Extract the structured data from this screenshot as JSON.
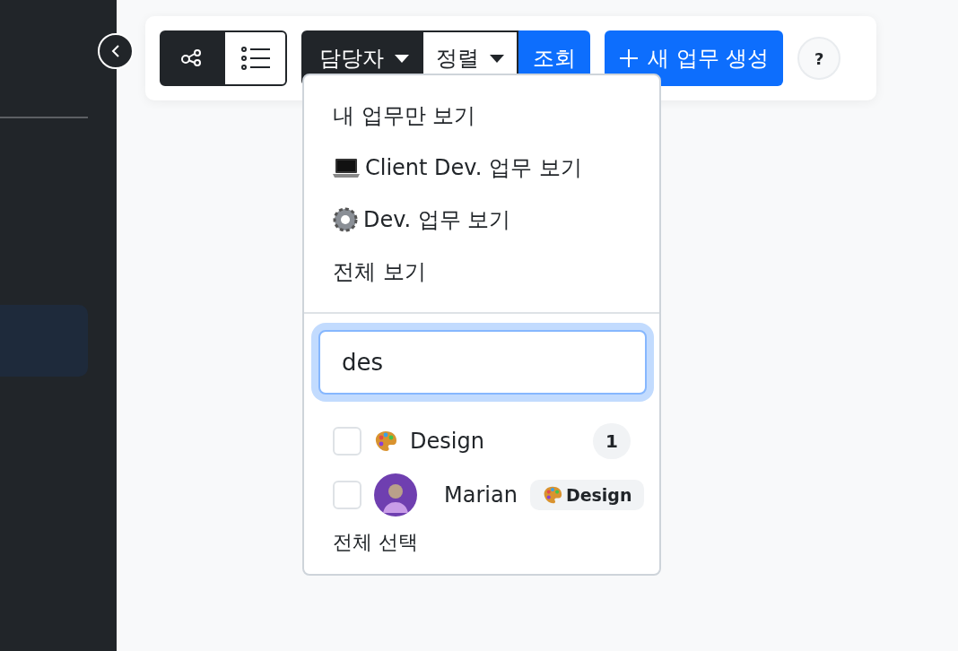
{
  "toolbar": {
    "view_toggle": [
      {
        "kind": "graph",
        "selected": true
      },
      {
        "kind": "list",
        "selected": false
      }
    ],
    "assignee_button": "담당자",
    "sort_button": "정렬",
    "search_button": "조회",
    "create_button": "새 업무 생성",
    "help_button": "?"
  },
  "dropdown": {
    "menu_items": [
      {
        "kind": "plain",
        "label": "내 업무만 보기"
      },
      {
        "kind": "laptop",
        "label": "Client Dev. 업무 보기"
      },
      {
        "kind": "gear",
        "label": "Dev. 업무 보기"
      },
      {
        "kind": "plain",
        "label": "전체 보기"
      }
    ],
    "search": {
      "value": "des"
    },
    "results": [
      {
        "kind": "team",
        "name": "Design",
        "count": "1",
        "checked": false
      },
      {
        "kind": "person",
        "name": "Marian",
        "team": "Design",
        "checked": false
      }
    ],
    "select_all": "전체 선택"
  }
}
